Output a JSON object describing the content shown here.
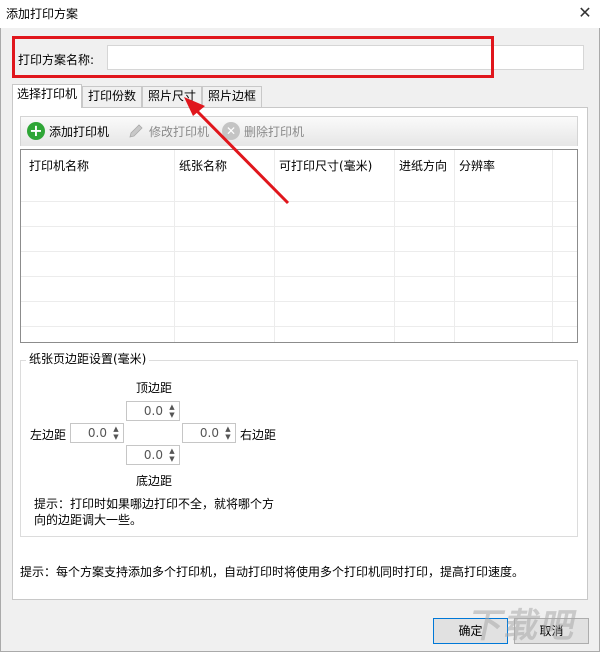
{
  "window": {
    "title": "添加打印方案"
  },
  "scheme_name": {
    "label": "打印方案名称:",
    "value": ""
  },
  "tabs": [
    {
      "label": "选择打印机",
      "active": true
    },
    {
      "label": "打印份数",
      "active": false
    },
    {
      "label": "照片尺寸",
      "active": false
    },
    {
      "label": "照片边框",
      "active": false
    }
  ],
  "toolbar": {
    "add_label": "添加打印机",
    "edit_label": "修改打印机",
    "delete_label": "删除打印机"
  },
  "table": {
    "columns": [
      "打印机名称",
      "纸张名称",
      "可打印尺寸(毫米)",
      "进纸方向",
      "分辨率"
    ],
    "rows": []
  },
  "margins": {
    "legend": "纸张页边距设置(毫米)",
    "top_label": "顶边距",
    "top_value": "0.0",
    "left_label": "左边距",
    "left_value": "0.0",
    "right_label": "右边距",
    "right_value": "0.0",
    "bottom_label": "底边距",
    "bottom_value": "0.0",
    "hint": "提示：打印时如果哪边打印不全，就将哪个方向的边距调大一些。"
  },
  "footer_hint": "提示：每个方案支持添加多个打印机，自动打印时将使用多个打印机同时打印，提高打印速度。",
  "buttons": {
    "ok": "确定",
    "cancel": "取消"
  },
  "watermark": "下载吧",
  "colors": {
    "highlight": "#e0161c",
    "add_icon": "#2fa637"
  }
}
